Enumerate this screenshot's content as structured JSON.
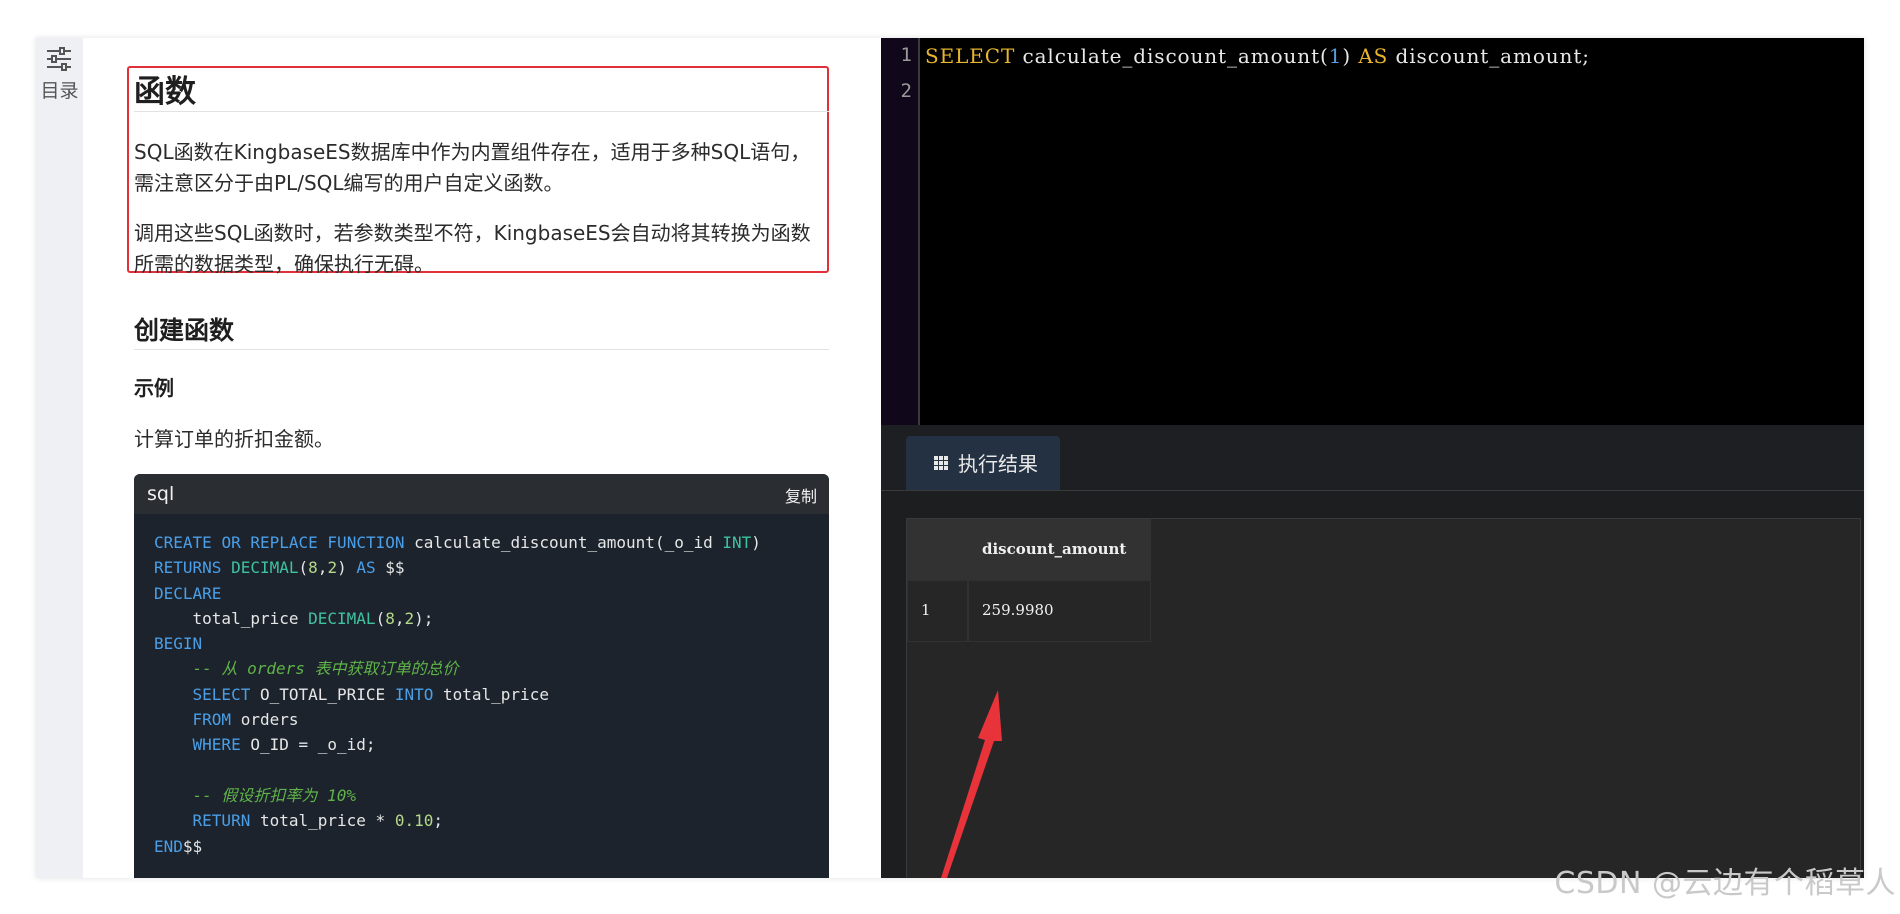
{
  "toc": {
    "label": "目录"
  },
  "doc": {
    "title": "函数",
    "para1": "SQL函数在KingbaseES数据库中作为内置组件存在，适用于多种SQL语句，需注意区分于由PL/SQL编写的用户自定义函数。",
    "para2": "调用这些SQL函数时，若参数类型不符，KingbaseES会自动将其转换为函数所需的数据类型，确保执行无碍。",
    "section_title": "创建函数",
    "example_title": "示例",
    "example_desc": "计算订单的折扣金额。",
    "code": {
      "lang": "sql",
      "copy_label": "复制",
      "lines": [
        "CREATE OR REPLACE FUNCTION calculate_discount_amount(_o_id INT)",
        "RETURNS DECIMAL(8,2) AS $$",
        "DECLARE",
        "    total_price DECIMAL(8,2);",
        "BEGIN",
        "    -- 从 orders 表中获取订单的总价",
        "    SELECT O_TOTAL_PRICE INTO total_price",
        "    FROM orders",
        "    WHERE O_ID = _o_id;",
        "",
        "    -- 假设折扣率为 10%",
        "    RETURN total_price * 0.10;",
        "END$$"
      ]
    }
  },
  "editor": {
    "line_numbers": [
      "1",
      "2"
    ],
    "sql_parts": [
      "SELECT",
      " calculate_discount_amount(",
      "1",
      ") ",
      "AS",
      " discount_amount;"
    ]
  },
  "results": {
    "tab_label": "执行结果",
    "columns": [
      "discount_amount"
    ],
    "rows": [
      [
        "1",
        "259.9980"
      ]
    ]
  },
  "watermark": "CSDN @云边有个稻草人",
  "colors": {
    "highlight_border": "#e0313a",
    "arrow": "#e8333b",
    "sql_keyword": "#e9b52f",
    "code_keyword": "#4a9fe8"
  }
}
